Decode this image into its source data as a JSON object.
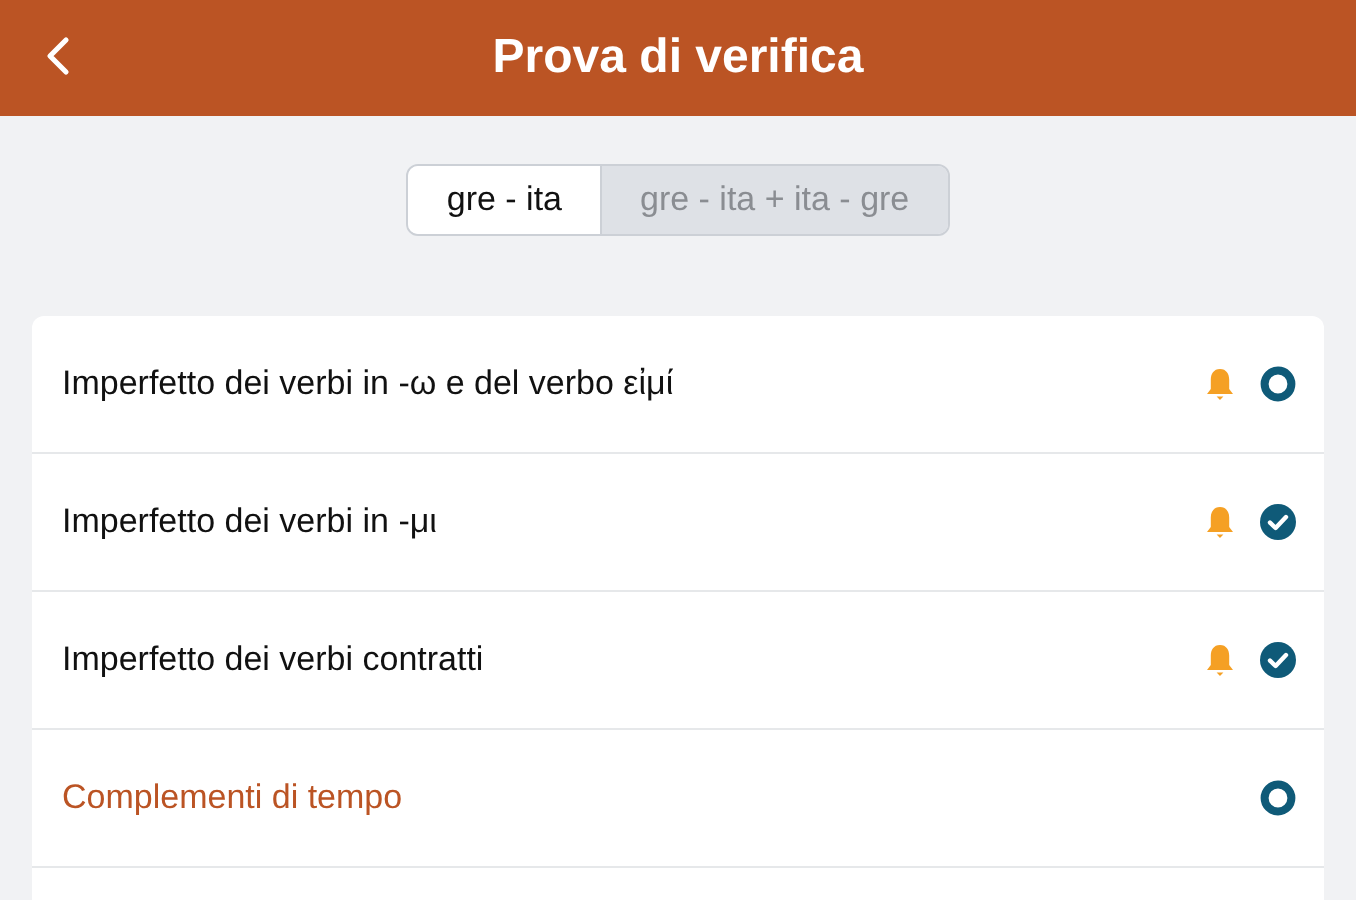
{
  "header": {
    "title": "Prova di verifica"
  },
  "tabs": [
    {
      "label": "gre - ita",
      "selected": true
    },
    {
      "label": "gre - ita + ita - gre",
      "selected": false
    }
  ],
  "items": [
    {
      "title": "Imperfetto dei verbi in -ω e del verbo εἰμί",
      "reminder": true,
      "completed": false,
      "highlighted": false
    },
    {
      "title": "Imperfetto dei verbi in -μι",
      "reminder": true,
      "completed": true,
      "highlighted": false
    },
    {
      "title": "Imperfetto dei verbi contratti",
      "reminder": true,
      "completed": true,
      "highlighted": false
    },
    {
      "title": "Complementi di tempo",
      "reminder": false,
      "completed": false,
      "highlighted": true
    }
  ]
}
